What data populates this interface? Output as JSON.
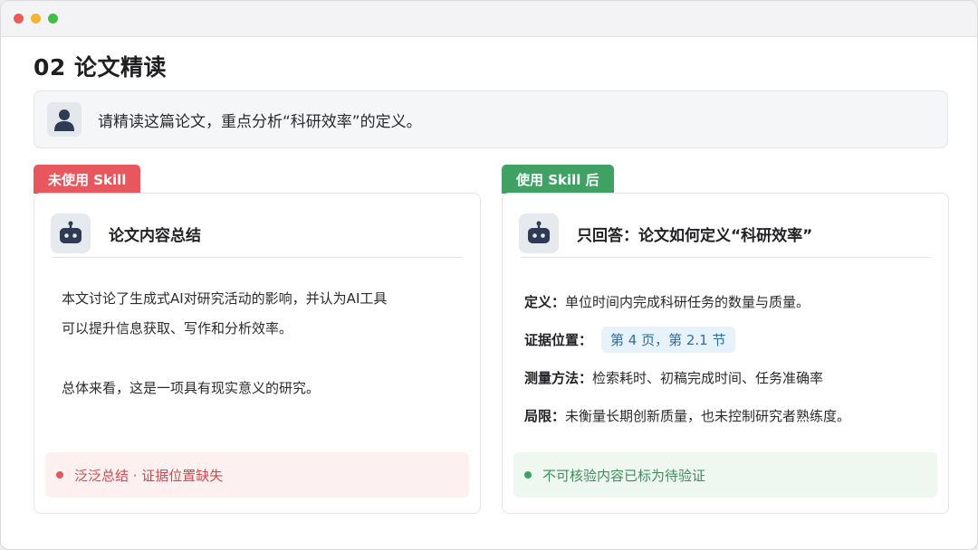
{
  "window": {
    "controls": [
      "close",
      "minimize",
      "zoom"
    ]
  },
  "page": {
    "title": "02 论文精读"
  },
  "prompt": {
    "avatar_icon": "user-icon",
    "text": "请精读这篇论文，重点分析“科研效率”的定义。"
  },
  "left_panel": {
    "tag": "未使用 Skill",
    "accent": "#e8575d",
    "avatar_icon": "robot-icon",
    "title": "论文内容总结",
    "paragraph1_line1": "本文讨论了生成式AI对研究活动的影响，并认为AI工具",
    "paragraph1_line2": "可以提升信息获取、写作和分析效率。",
    "paragraph2": "总体来看，这是一项具有现实意义的研究。",
    "status": "泛泛总结 · 证据位置缺失"
  },
  "right_panel": {
    "tag": "使用 Skill 后",
    "accent": "#3fa163",
    "avatar_icon": "robot-icon",
    "title": "只回答：论文如何定义“科研效率”",
    "fields": [
      {
        "label": "定义：",
        "value": "单位时间内完成科研任务的数量与质量。"
      },
      {
        "label": "证据位置：",
        "value": "第 4 页，第 2.1 节"
      },
      {
        "label": "测量方法：",
        "value": "检索耗时、初稿完成时间、任务准确率"
      },
      {
        "label": "局限：",
        "value": "未衡量长期创新质量，也未控制研究者熟练度。"
      }
    ],
    "status": "不可核验内容已标为待验证"
  }
}
